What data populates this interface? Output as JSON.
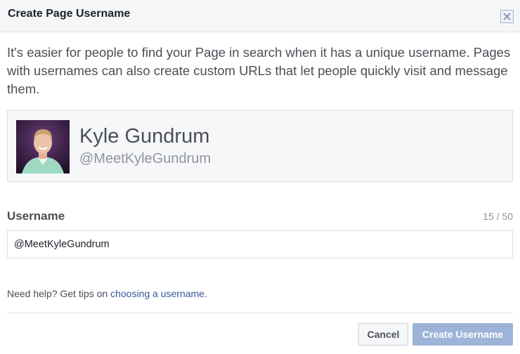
{
  "dialog": {
    "title": "Create Page Username",
    "close_icon": "close-icon"
  },
  "description": "It's easier for people to find your Page in search when it has a unique username. Pages with usernames can also create custom URLs that let people quickly visit and message them.",
  "preview": {
    "name": "Kyle Gundrum",
    "handle": "@MeetKyleGundrum"
  },
  "username_field": {
    "label": "Username",
    "counter": "15 / 50",
    "value": "@MeetKyleGundrum"
  },
  "help": {
    "prefix": "Need help? Get tips on ",
    "link": "choosing a username",
    "suffix": "."
  },
  "buttons": {
    "cancel": "Cancel",
    "create": "Create Username"
  },
  "colors": {
    "link": "#365899",
    "create_button": "#9cb4d8",
    "header_bg": "#f5f6f7"
  }
}
